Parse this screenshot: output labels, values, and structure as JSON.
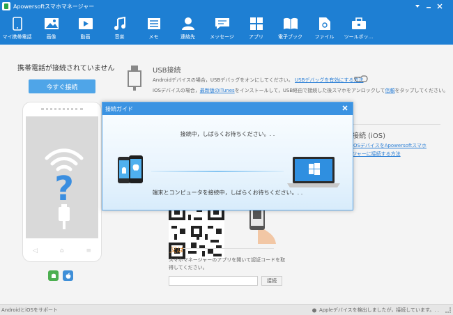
{
  "window": {
    "title": "Apowersoftスマホマネージャー"
  },
  "toolbar": {
    "items": [
      {
        "label": "マイ携帯電話",
        "icon": "phone-icon"
      },
      {
        "label": "画像",
        "icon": "picture-icon"
      },
      {
        "label": "動画",
        "icon": "video-icon"
      },
      {
        "label": "音楽",
        "icon": "music-icon"
      },
      {
        "label": "メモ",
        "icon": "memo-icon"
      },
      {
        "label": "連絡先",
        "icon": "contact-icon"
      },
      {
        "label": "メッセージ",
        "icon": "message-icon"
      },
      {
        "label": "アプリ",
        "icon": "apps-icon"
      },
      {
        "label": "電子ブック",
        "icon": "ebook-icon"
      },
      {
        "label": "ファイル",
        "icon": "file-icon"
      },
      {
        "label": "ツールボッ...",
        "icon": "toolbox-icon"
      }
    ]
  },
  "left": {
    "title": "携帯電話が接続されていません",
    "connect_button": "今すぐ接続"
  },
  "usb": {
    "title": "USB接続",
    "line1_text": "Androidデバイスの場合，USBデバッグをオンにしてください。",
    "line1_link": "USBデバッグを有効にする方法",
    "line2_pre": "iOSデバイスの場合，",
    "line2_link": "最新版のiTunes",
    "line2_mid": "をインストールして，USB経由で接続した後スマホをアンロックして",
    "line2_link2": "信頼",
    "line2_post": "をタップしてください。"
  },
  "wifi": {
    "title": "接続 (iOS)",
    "line1": "iOSデバイスをApowersoftスマホ",
    "line2": "ジャーに接続する方法"
  },
  "auth": {
    "or_label": "又は",
    "text": "スマホマネージャーのアプリを開いて認証コードを取得してください。",
    "input_placeholder": "",
    "button": "接続"
  },
  "dialog": {
    "title": "接続ガイド",
    "message_top": "接続中，しばらくお待ちください。. .",
    "message_bottom": "端末とコンピュータを接続中，しばらくお待ちください。. ."
  },
  "status": {
    "left": "AndroidとiOSをサポート",
    "right": "Appleデバイスを検出しましたが，接続しています。. ."
  },
  "colors": {
    "brand": "#1e7fd3",
    "accent": "#4fa5e8",
    "link": "#2b7fd6"
  }
}
